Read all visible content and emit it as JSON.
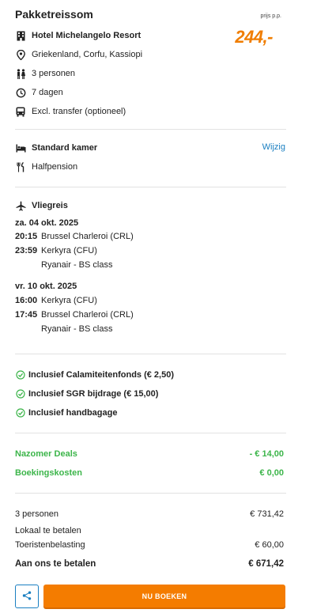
{
  "header": {
    "title": "Pakketreissom",
    "price_label": "prijs p.p.",
    "price": "244,-"
  },
  "summary": {
    "hotel": "Hotel Michelangelo Resort",
    "location": "Griekenland, Corfu, Kassiopi",
    "persons": "3 personen",
    "duration": "7 dagen",
    "transfer": "Excl. transfer",
    "transfer_note": "(optioneel)"
  },
  "room": {
    "type": "Standard kamer",
    "change_link": "Wijzig",
    "board": "Halfpension"
  },
  "flight": {
    "heading": "Vliegreis",
    "outbound": {
      "date": "za. 04 okt. 2025",
      "dep_time": "20:15",
      "dep_airport": "Brussel Charleroi (CRL)",
      "arr_time": "23:59",
      "arr_airport": "Kerkyra (CFU)",
      "carrier": "Ryanair - BS class"
    },
    "return": {
      "date": "vr. 10 okt. 2025",
      "dep_time": "16:00",
      "dep_airport": "Kerkyra (CFU)",
      "arr_time": "17:45",
      "arr_airport": "Brussel Charleroi (CRL)",
      "carrier": "Ryanair - BS class"
    }
  },
  "inclusions": [
    "Inclusief Calamiteitenfonds (€ 2,50)",
    "Inclusief SGR bijdrage (€ 15,00)",
    "Inclusief handbagage"
  ],
  "discounts": {
    "deals_label": "Nazomer Deals",
    "deals_value": "- € 14,00",
    "booking_label": "Boekingskosten",
    "booking_value": "€ 0,00"
  },
  "totals": {
    "persons_label": "3 personen",
    "persons_value": "€ 731,42",
    "local_label": "Lokaal te betalen",
    "tourist_tax_label": "Toeristenbelasting",
    "tourist_tax_value": "€ 60,00",
    "pay_label": "Aan ons te betalen",
    "pay_value": "€ 671,42"
  },
  "actions": {
    "book_label": "NU BOEKEN"
  },
  "colors": {
    "accent": "#f07d00",
    "link": "#1a7fc1",
    "success": "#3cb54a"
  }
}
